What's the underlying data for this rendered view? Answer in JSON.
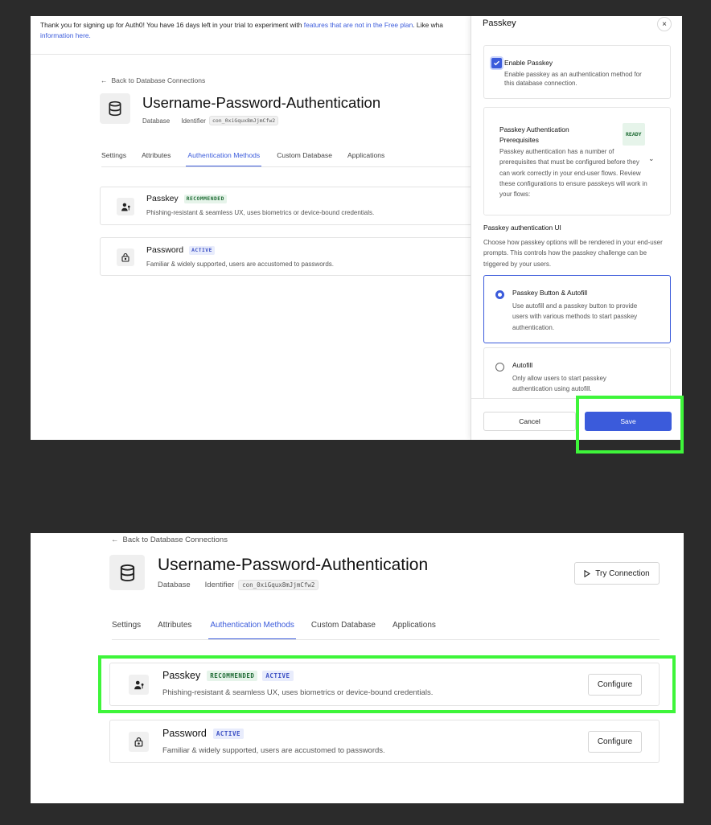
{
  "top": {
    "banner": {
      "text_before": "Thank you for signing up for Auth0! You have 16 days left in your trial to experiment with ",
      "link_features": "features that are not in the Free plan",
      "text_after": ". Like wha",
      "link_info": "information here."
    },
    "back_link": "Back to Database Connections",
    "title": "Username-Password-Authentication",
    "type_label": "Database",
    "identifier_label": "Identifier",
    "identifier_value": "con_0xiGqux8mJjmCfw2",
    "tabs": [
      "Settings",
      "Attributes",
      "Authentication Methods",
      "Custom Database",
      "Applications"
    ],
    "methods": [
      {
        "name": "Passkey",
        "badge": "RECOMMENDED",
        "desc": "Phishing-resistant & seamless UX, uses biometrics or device-bound credentials."
      },
      {
        "name": "Password",
        "badge": "ACTIVE",
        "desc": "Familiar & widely supported, users are accustomed to passwords."
      }
    ],
    "drawer": {
      "title": "Passkey",
      "close": "×",
      "enable_label": "Enable Passkey",
      "enable_desc": "Enable passkey as an authentication method for this database connection.",
      "prereq_title": "Passkey Authentication Prerequisites",
      "prereq_badge": "READY",
      "prereq_desc": "Passkey authentication has a number of prerequisites that must be configured before they can work correctly in your end-user flows. Review these configurations to ensure passkeys will work in your flows:",
      "ui_heading": "Passkey authentication UI",
      "ui_desc": "Choose how passkey options will be rendered in your end-user prompts. This controls how the passkey challenge can be triggered by your users.",
      "options": [
        {
          "label": "Passkey Button & Autofill",
          "desc": "Use autofill and a passkey button to provide users with various methods to start passkey authentication.",
          "selected": true
        },
        {
          "label": "Autofill",
          "desc": "Only allow users to start passkey authentication using autofill.",
          "selected": false
        }
      ],
      "cancel": "Cancel",
      "save": "Save"
    }
  },
  "bottom": {
    "back_link": "Back to Database Connections",
    "title": "Username-Password-Authentication",
    "type_label": "Database",
    "identifier_label": "Identifier",
    "identifier_value": "con_0xiGqux8mJjmCfw2",
    "try_connection": "Try Connection",
    "tabs": [
      "Settings",
      "Attributes",
      "Authentication Methods",
      "Custom Database",
      "Applications"
    ],
    "methods": [
      {
        "name": "Passkey",
        "badge1": "RECOMMENDED",
        "badge2": "ACTIVE",
        "desc": "Phishing-resistant & seamless UX, uses biometrics or device-bound credentials.",
        "button": "Configure"
      },
      {
        "name": "Password",
        "badge1": "ACTIVE",
        "desc": "Familiar & widely supported, users are accustomed to passwords.",
        "button": "Configure"
      }
    ]
  },
  "colors": {
    "accent": "#3b5bdb",
    "highlight": "#3ef53a",
    "recommended_bg": "#e6f4ea",
    "active_bg": "#e8ecfc"
  }
}
